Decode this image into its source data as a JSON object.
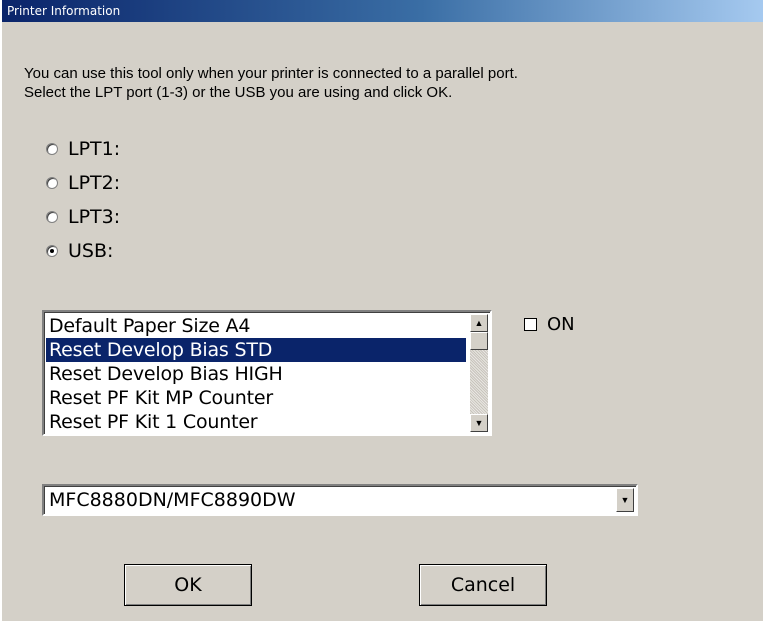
{
  "window": {
    "title": "Printer Information"
  },
  "instructions": {
    "line1": "You can use this tool only when your printer is connected to a parallel port.",
    "line2": "Select the LPT port (1-3) or the USB you are using and click OK."
  },
  "ports": [
    {
      "label": "LPT1:",
      "checked": false
    },
    {
      "label": "LPT2:",
      "checked": false
    },
    {
      "label": "LPT3:",
      "checked": false
    },
    {
      "label": "USB:",
      "checked": true
    }
  ],
  "settings_list": {
    "items": [
      "Default Paper Size A4",
      "Reset Develop Bias STD",
      "Reset Develop Bias HIGH",
      "Reset PF Kit MP Counter",
      "Reset PF Kit 1 Counter"
    ],
    "selected_index": 1
  },
  "on_checkbox": {
    "label": "ON",
    "checked": false
  },
  "model_select": {
    "value": "MFC8880DN/MFC8890DW"
  },
  "buttons": {
    "ok": "OK",
    "cancel": "Cancel"
  },
  "icons": {
    "scroll_up": "scroll-up-arrow-icon",
    "scroll_down": "scroll-down-arrow-icon",
    "dropdown": "dropdown-arrow-icon"
  },
  "colors": {
    "selection": "#0a246a",
    "face": "#d4d0c8"
  }
}
